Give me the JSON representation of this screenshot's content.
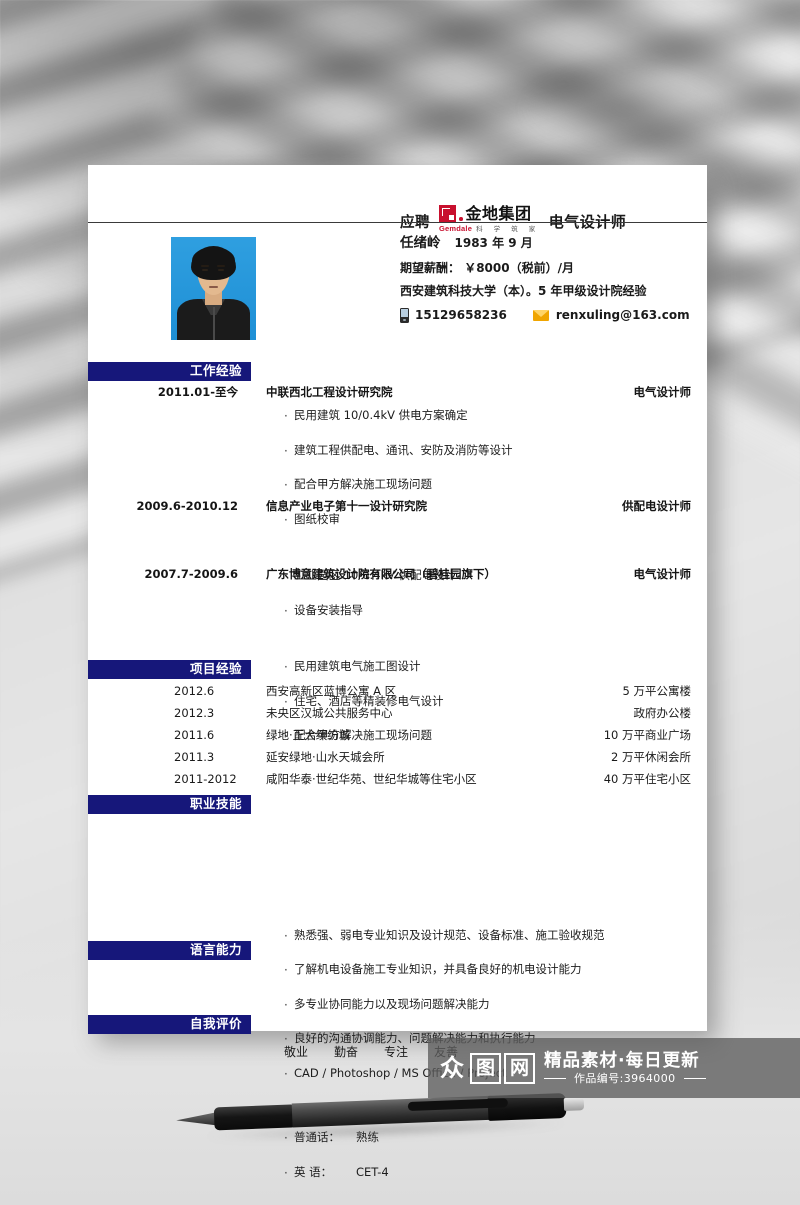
{
  "header": {
    "apply_label": "应聘",
    "role": "电气设计师",
    "logo": {
      "cn_name": "金地集团",
      "latin_name": "Gemdale",
      "slogan": "科 学 筑 家"
    }
  },
  "personal": {
    "name": "任绪岭",
    "birth": "1983 年 9 月",
    "salary_label": "期望薪酬：",
    "salary_value": "￥8000（税前）/月",
    "education": "西安建筑科技大学（本）。5 年甲级设计院经验",
    "phone": "15129658236",
    "email": "renxuling@163.com"
  },
  "sections": {
    "work": {
      "title": "工作经验",
      "jobs": [
        {
          "date": "2011.01-至今",
          "org": "中联西北工程设计研究院",
          "role": "电气设计师",
          "bullets": [
            "民用建筑 10/0.4kV 供电方案确定",
            "建筑工程供配电、通讯、安防及消防等设计",
            "配合甲方解决施工现场问题",
            "图纸校审"
          ]
        },
        {
          "date": "2009.6-2010.12",
          "org": "信息产业电子第十一设计研究院",
          "role": "供配电设计师",
          "bullets": [
            "工业园区 10/0.4kV 供配电设计",
            "设备安装指导"
          ]
        },
        {
          "date": "2007.7-2009.6",
          "org": "广东博意建筑设计院有限公司（碧桂园旗下）",
          "role": "电气设计师",
          "bullets": [
            "民用建筑电气施工图设计",
            "住宅、酒店等精装修电气设计",
            "配合甲方解决施工现场问题"
          ]
        }
      ]
    },
    "projects": {
      "title": "项目经验",
      "rows": [
        {
          "date": "2012.6",
          "name": "西安高新区蓝博公寓 A 区",
          "size": "5 万平公寓楼"
        },
        {
          "date": "2012.3",
          "name": "未央区汉城公共服务中心",
          "size": "政府办公楼"
        },
        {
          "date": "2011.6",
          "name": "绿地·正大缤纷城",
          "size": "10 万平商业广场"
        },
        {
          "date": "2011.3",
          "name": "延安绿地·山水天城会所",
          "size": "2 万平休闲会所"
        },
        {
          "date": "2011-2012",
          "name": "咸阳华泰·世纪华苑、世纪华城等住宅小区",
          "size": "40 万平住宅小区"
        }
      ]
    },
    "skills": {
      "title": "职业技能",
      "items": [
        "熟悉强、弱电专业知识及设计规范、设备标准、施工验收规范",
        "了解机电设备施工专业知识，并具备良好的机电设计能力",
        "多专业协同能力以及现场问题解决能力",
        "良好的沟通协调能力、问题解决能力和执行能力",
        "CAD / Photoshop / MS Office / Project"
      ]
    },
    "language": {
      "title": "语言能力",
      "rows": [
        {
          "label": "普通话：",
          "value": "熟练"
        },
        {
          "label": "英  语：",
          "value": "CET-4"
        }
      ]
    },
    "evaluation": {
      "title": "自我评价",
      "words": [
        "敬业",
        "勤奋",
        "专注",
        "友善"
      ]
    }
  },
  "watermark": {
    "logo_chars": [
      "众",
      "图",
      "网"
    ],
    "title": "精品素材·每日更新",
    "subtitle": "作品编号:3964000"
  },
  "colors": {
    "section_bar": "#16177a",
    "logo_red": "#c8102e",
    "mail_icon": "#f0a500",
    "photo_bg": "#2f9fe0"
  }
}
